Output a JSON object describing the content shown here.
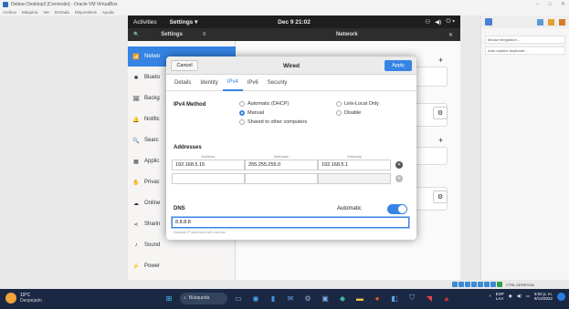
{
  "host": {
    "title": "Debian Desktop2 [Corriendo] - Oracle VM VirtualBox",
    "menu": [
      "Archivo",
      "Máquina",
      "Ver",
      "Entrada",
      "Dispositivos",
      "Ayuda"
    ],
    "window_controls": [
      "–",
      "□",
      "✕"
    ]
  },
  "gnome": {
    "activities": "Activities",
    "app_menu": "Settings ▾",
    "clock": "Dec 9  21:02",
    "tray": [
      "⚇",
      "◀)",
      "⏻ ▾"
    ]
  },
  "settings": {
    "search_glyph": "🔍",
    "title": "Settings",
    "hamburger": "≡",
    "panel_title": "Network",
    "close": "✕",
    "sidebar": [
      {
        "icon": "📶",
        "label": "Netwo",
        "active": true
      },
      {
        "icon": "✱",
        "label": "Blueto"
      },
      {
        "icon": "🖼",
        "label": "Backg"
      },
      {
        "icon": "🔔",
        "label": "Notific"
      },
      {
        "icon": "🔍",
        "label": "Searc"
      },
      {
        "icon": "▦",
        "label": "Applic"
      },
      {
        "icon": "✋",
        "label": "Privac"
      },
      {
        "icon": "☁",
        "label": "Online"
      },
      {
        "icon": "≺",
        "label": "Sharin"
      },
      {
        "icon": "♪",
        "label": "Sound"
      },
      {
        "icon": "⚡",
        "label": "Power"
      }
    ],
    "bg_plus": "+",
    "bg_gear": "⚙"
  },
  "dialog": {
    "cancel": "Cancel",
    "title": "Wired",
    "apply": "Apply",
    "tabs": [
      "Details",
      "Identity",
      "IPv4",
      "IPv6",
      "Security"
    ],
    "selected_tab": "IPv4",
    "ipv4_method_label": "IPv4 Method",
    "methods": {
      "auto": "Automatic (DHCP)",
      "manual": "Manual",
      "shared": "Shared to other computers",
      "link_local": "Link-Local Only",
      "disable": "Disable"
    },
    "selected_method": "Manual",
    "addresses_label": "Addresses",
    "col_address": "Address",
    "col_netmask": "Netmask",
    "col_gateway": "Gateway",
    "row1": {
      "address": "192.168.5.15",
      "netmask": "255.255.255.0",
      "gateway": "192.168.5.1"
    },
    "row2": {
      "address": "",
      "netmask": "",
      "gateway": ""
    },
    "remove_glyph": "✕",
    "dns_label": "DNS",
    "dns_automatic_label": "Automatic",
    "dns_automatic_on": true,
    "dns_value": "8.8.8.8",
    "dns_hint": "Separate IP addresses with commas"
  },
  "right_panel": {
    "items": [
      "Mouse integration ...",
      "Auto capture keyboard ..."
    ]
  },
  "status_strip": {
    "label": "CTRL DERECHA"
  },
  "taskbar": {
    "temp": "19°C",
    "condition": "Despejado",
    "search_label": "Búsqueda",
    "lang1": "ESP",
    "lang2": "LAA",
    "time": "9:02 p. m.",
    "date": "9/12/2022",
    "chevron": "^"
  },
  "colors": {
    "accent": "#3584e4",
    "taskbar": "#1a2844"
  }
}
